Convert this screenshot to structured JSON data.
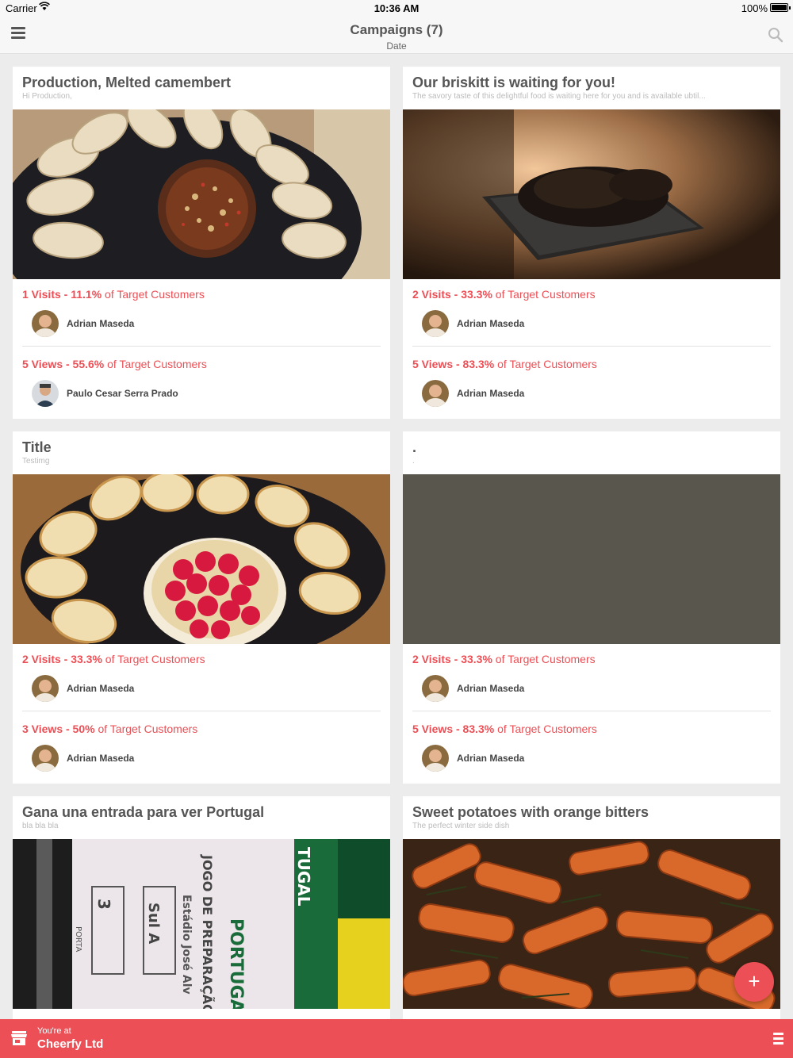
{
  "status_bar": {
    "carrier": "Carrier",
    "time": "10:36 AM",
    "battery": "100%"
  },
  "nav": {
    "title": "Campaigns (7)",
    "subtitle": "Date",
    "menu_icon": "hamburger-icon",
    "search_icon": "search-icon"
  },
  "campaigns": [
    {
      "title": "Production, Melted camembert",
      "subtitle": "Hi Production,",
      "image": "camembert-bread-platter",
      "visits": {
        "count": "1 Visits - 11.1%",
        "suffix": " of Target Customers",
        "person": "Adrian Maseda"
      },
      "views": {
        "count": "5 Views - 55.6%",
        "suffix": " of Target Customers",
        "person": "Paulo Cesar Serra Prado"
      }
    },
    {
      "title": "Our briskitt is waiting for you!",
      "subtitle": "The savory taste of this delightful food is waiting here for you and is available ubtil...",
      "image": "brisket-tray",
      "visits": {
        "count": "2 Visits - 33.3%",
        "suffix": " of Target Customers",
        "person": "Adrian Maseda"
      },
      "views": {
        "count": "5 Views - 83.3%",
        "suffix": " of Target Customers",
        "person": "Adrian Maseda"
      }
    },
    {
      "title": "Title",
      "subtitle": "Testimg",
      "image": "raspberry-brie-platter",
      "visits": {
        "count": "2 Visits - 33.3%",
        "suffix": " of Target Customers",
        "person": "Adrian Maseda"
      },
      "views": {
        "count": "3 Views - 50%",
        "suffix": " of Target Customers",
        "person": "Adrian Maseda"
      }
    },
    {
      "title": ".",
      "subtitle": ".",
      "image": "grey-surface",
      "visits": {
        "count": "2 Visits - 33.3%",
        "suffix": " of Target Customers",
        "person": "Adrian Maseda"
      },
      "views": {
        "count": "5 Views - 83.3%",
        "suffix": " of Target Customers",
        "person": "Adrian Maseda"
      }
    },
    {
      "title": "Gana una entrada para ver Portugal",
      "subtitle": "bla bla bla",
      "image": "portugal-ticket",
      "ticket": {
        "word1": "PORTUGAL",
        "word2": "JOGO DE PREPARAÇÃO",
        "word3": "Estádio José Alv",
        "sector": "Sul A",
        "door_num": "3",
        "door": "PORTA",
        "brand": "TUGAL"
      }
    },
    {
      "title": "Sweet potatoes with orange bitters",
      "subtitle": "The perfect winter side dish",
      "image": "roasted-sweet-potatoes"
    }
  ],
  "fab": {
    "label": "+"
  },
  "bottom_bar": {
    "at_label": "You're at",
    "venue": "Cheerfy Ltd",
    "store_icon": "store-icon",
    "list_icon": "list-icon"
  },
  "colors": {
    "accent": "#ec4f55",
    "background": "#ececec",
    "card": "#ffffff"
  }
}
